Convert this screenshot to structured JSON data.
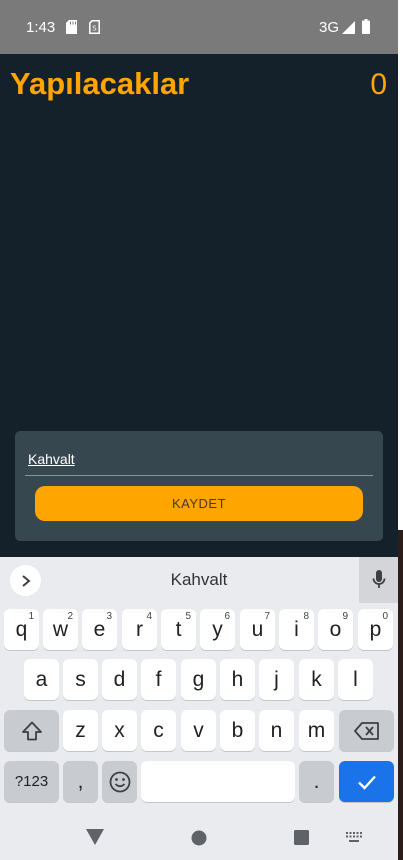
{
  "status_bar": {
    "time": "1:43",
    "network": "3G",
    "icons": [
      "sd-card-icon",
      "sim-icon",
      "signal-icon",
      "battery-icon"
    ]
  },
  "app": {
    "title": "Yapılacaklar",
    "count": "0"
  },
  "form": {
    "input_value": "Kahvalt",
    "save_label": "KAYDET"
  },
  "keyboard": {
    "suggestion": "Kahvalt",
    "row1": [
      {
        "key": "q",
        "hint": "1"
      },
      {
        "key": "w",
        "hint": "2"
      },
      {
        "key": "e",
        "hint": "3"
      },
      {
        "key": "r",
        "hint": "4"
      },
      {
        "key": "t",
        "hint": "5"
      },
      {
        "key": "y",
        "hint": "6"
      },
      {
        "key": "u",
        "hint": "7"
      },
      {
        "key": "i",
        "hint": "8"
      },
      {
        "key": "o",
        "hint": "9"
      },
      {
        "key": "p",
        "hint": "0"
      }
    ],
    "row2": [
      "a",
      "s",
      "d",
      "f",
      "g",
      "h",
      "j",
      "k",
      "l"
    ],
    "row3": [
      "z",
      "x",
      "c",
      "v",
      "b",
      "n",
      "m"
    ],
    "symbols_label": "?123",
    "comma_label": ",",
    "period_label": "."
  },
  "colors": {
    "accent": "#ffa500",
    "background": "#14212b",
    "card": "#37474f",
    "enter_key": "#1a73e8"
  }
}
